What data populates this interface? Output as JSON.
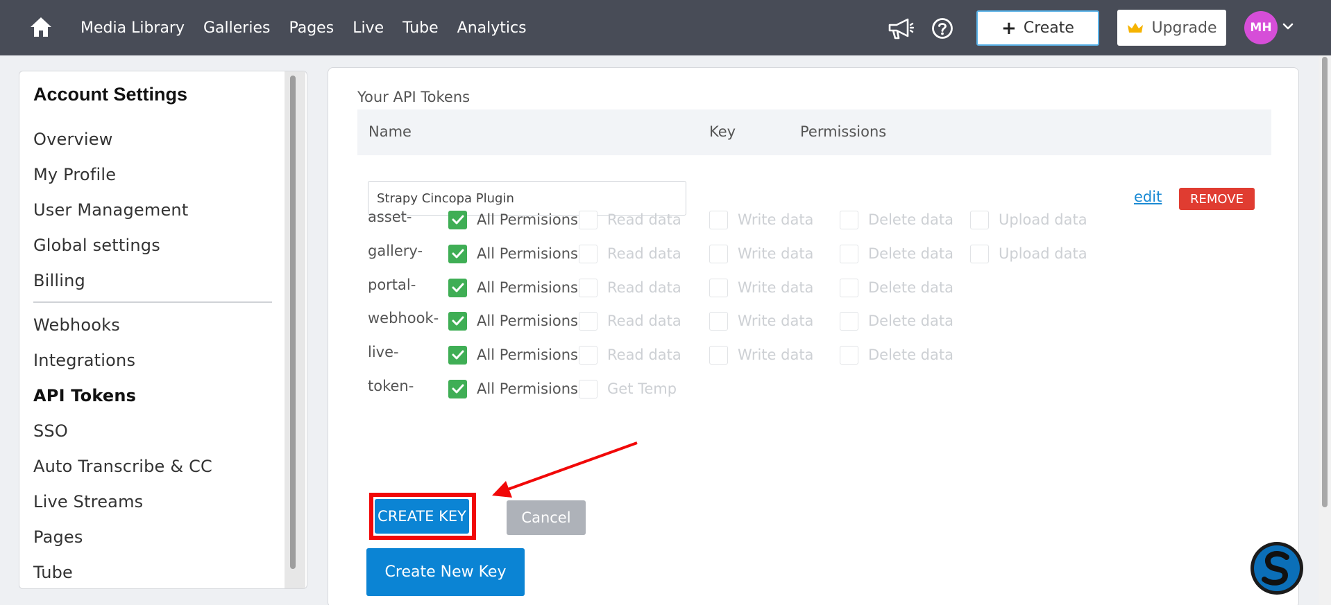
{
  "nav": {
    "links": [
      "Media Library",
      "Galleries",
      "Pages",
      "Live",
      "Tube",
      "Analytics"
    ],
    "create_label": "Create",
    "upgrade_label": "Upgrade",
    "avatar_initials": "MH"
  },
  "sidebar": {
    "title": "Account Settings",
    "group1": [
      "Overview",
      "My Profile",
      "User Management",
      "Global settings",
      "Billing"
    ],
    "group2": [
      "Webhooks",
      "Integrations",
      "API Tokens",
      "SSO",
      "Auto Transcribe & CC",
      "Live Streams",
      "Pages",
      "Tube"
    ],
    "active": "API Tokens"
  },
  "main": {
    "section_title": "Your API Tokens",
    "columns": {
      "name": "Name",
      "key": "Key",
      "permissions": "Permissions"
    },
    "token_name_value": "Strapy Cincopa Plugin",
    "edit_label": "edit",
    "remove_label": "REMOVE",
    "permission_rows": [
      {
        "label": "asset-",
        "items": [
          {
            "text": "All Permisions",
            "checked": true
          },
          {
            "text": "Read data",
            "checked": false
          },
          {
            "text": "Write data",
            "checked": false
          },
          {
            "text": "Delete data",
            "checked": false
          },
          {
            "text": "Upload data",
            "checked": false
          }
        ]
      },
      {
        "label": "gallery-",
        "items": [
          {
            "text": "All Permisions",
            "checked": true
          },
          {
            "text": "Read data",
            "checked": false
          },
          {
            "text": "Write data",
            "checked": false
          },
          {
            "text": "Delete data",
            "checked": false
          },
          {
            "text": "Upload data",
            "checked": false
          }
        ]
      },
      {
        "label": "portal-",
        "items": [
          {
            "text": "All Permisions",
            "checked": true
          },
          {
            "text": "Read data",
            "checked": false
          },
          {
            "text": "Write data",
            "checked": false
          },
          {
            "text": "Delete data",
            "checked": false
          }
        ]
      },
      {
        "label": "webhook-",
        "items": [
          {
            "text": "All Permisions",
            "checked": true
          },
          {
            "text": "Read data",
            "checked": false
          },
          {
            "text": "Write data",
            "checked": false
          },
          {
            "text": "Delete data",
            "checked": false
          }
        ]
      },
      {
        "label": "live-",
        "items": [
          {
            "text": "All Permisions",
            "checked": true
          },
          {
            "text": "Read data",
            "checked": false
          },
          {
            "text": "Write data",
            "checked": false
          },
          {
            "text": "Delete data",
            "checked": false
          }
        ]
      },
      {
        "label": "token-",
        "items": [
          {
            "text": "All Permisions",
            "checked": true
          },
          {
            "text": "Get Temp",
            "checked": false
          }
        ]
      }
    ],
    "create_key_label": "CREATE KEY",
    "cancel_label": "Cancel",
    "create_new_key_label": "Create New Key"
  },
  "colors": {
    "topbar": "#484c57",
    "primary": "#0b84d4",
    "check": "#3fae55",
    "remove": "#e03c31",
    "annotation": "#f10808"
  }
}
